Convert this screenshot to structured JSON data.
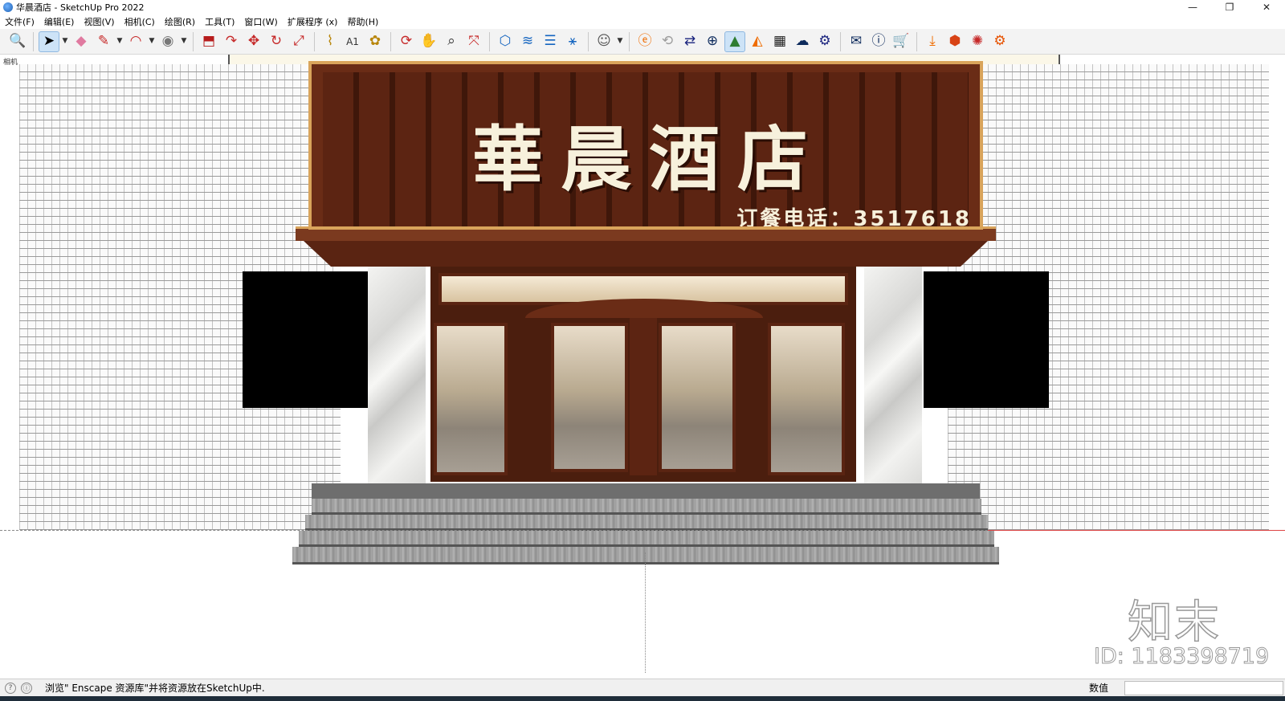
{
  "window": {
    "title": "华晨酒店 - SketchUp Pro 2022",
    "minimize": "—",
    "restore": "❐",
    "close": "✕"
  },
  "menu": [
    "文件(F)",
    "编辑(E)",
    "视图(V)",
    "相机(C)",
    "绘图(R)",
    "工具(T)",
    "窗口(W)",
    "扩展程序 (x)",
    "帮助(H)"
  ],
  "toolbar": {
    "icons": [
      "zoom-extents-icon",
      "select-icon",
      "eraser-icon",
      "pencil-icon",
      "arc-icon",
      "paint-bucket-icon",
      "push-pull-icon",
      "follow-me-icon",
      "move-icon",
      "rotate-icon",
      "scale-icon",
      "tape-measure-icon",
      "text-icon",
      "paint-icon",
      "orbit-icon",
      "pan-icon",
      "zoom-icon",
      "zoom-window-icon",
      "component-icon",
      "layer-icon",
      "style-icon",
      "outliner-icon",
      "user-icon",
      "enscape-start-icon",
      "enscape-sync-icon",
      "enscape-capture-icon",
      "add-icon",
      "tree-icon",
      "material-icon",
      "checker-icon",
      "upload-icon",
      "settings-icon",
      "mail-icon",
      "info-icon",
      "cart-icon",
      "download-icon",
      "box-icon",
      "plugin-icon",
      "gear-icon"
    ]
  },
  "viewport": {
    "scene_tag": "相机"
  },
  "signboard": {
    "title": "華晨酒店",
    "phone": "订餐电话：3517618"
  },
  "watermark": {
    "logo": "知末",
    "id": "ID: 1183398719"
  },
  "statusbar": {
    "text": "浏览\" Enscape 资源库\"并将资源放在SketchUp中.",
    "measure_label": "数值",
    "measure_value": ""
  }
}
